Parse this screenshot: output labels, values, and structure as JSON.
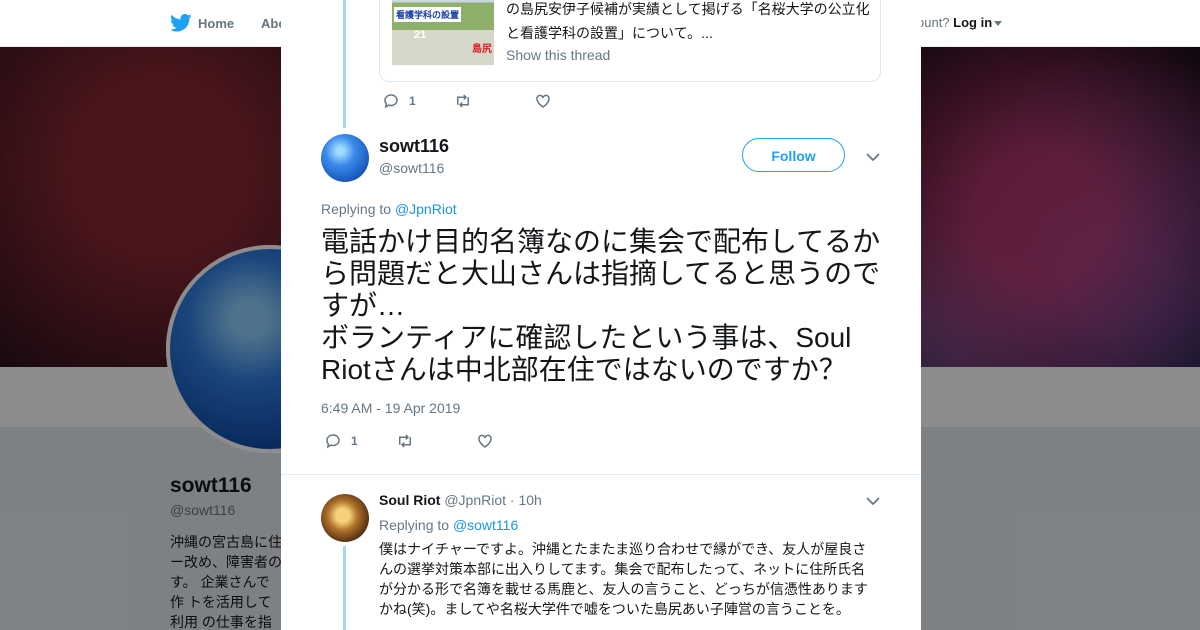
{
  "nav": {
    "home_label": "Home",
    "about_label": "Abo",
    "account_prompt": "ccount?",
    "login_label": "Log in"
  },
  "profile": {
    "name": "sowt116",
    "handle": "@sowt116",
    "bio": "沖縄の宮古島に住 ー改め、障害者の す。 企業さんで作 トを活用して利用 の仕事を指導して"
  },
  "quoted_tweet": {
    "thumb_title": "看護学科の設置",
    "thumb_number": "21",
    "thumb_tag": "島尻",
    "text": "の島尻安伊子候補が実績として掲げる「名桜大学の公立化と看護学科の設置」について。...",
    "show_thread": "Show this thread"
  },
  "prev_actions": {
    "reply_count": "1"
  },
  "main_tweet": {
    "author_name": "sowt116",
    "author_handle": "@sowt116",
    "follow_label": "Follow",
    "replying_prefix": "Replying to",
    "replying_to": "@JpnRiot",
    "text": "電話かけ目的名簿なのに集会で配布してるから問題だと大山さんは指摘してると思うのですが…\nボランティアに確認したという事は、Soul Riotさんは中北部在住ではないのですか？",
    "timestamp": "6:49 AM - 19 Apr 2019",
    "reply_count": "1"
  },
  "reply_tweet": {
    "author_name": "Soul Riot",
    "author_handle": "@JpnRiot",
    "time_ago": "· 10h",
    "replying_prefix": "Replying to",
    "replying_to": "@sowt116",
    "text": "僕はナイチャーですよ。沖縄とたまたま巡り合わせで縁ができ、友人が屋良さんの選挙対策本部に出入りしてます。集会で配布したって、ネットに住所氏名が分かる形で名簿を載せる馬鹿と、友人の言うこと、どっちが信憑性ありますかね(笑)。ましてや名桜大学件で嘘をついた島尻あい子陣営の言うことを。"
  },
  "colors": {
    "accent": "#1da1f2",
    "link": "#1b95e0",
    "thread_line": "#a0d7f5",
    "muted": "#657786"
  },
  "icons": [
    "twitter-bird-icon",
    "close-icon",
    "reply-icon",
    "retweet-icon",
    "like-icon",
    "chevron-down-icon"
  ]
}
